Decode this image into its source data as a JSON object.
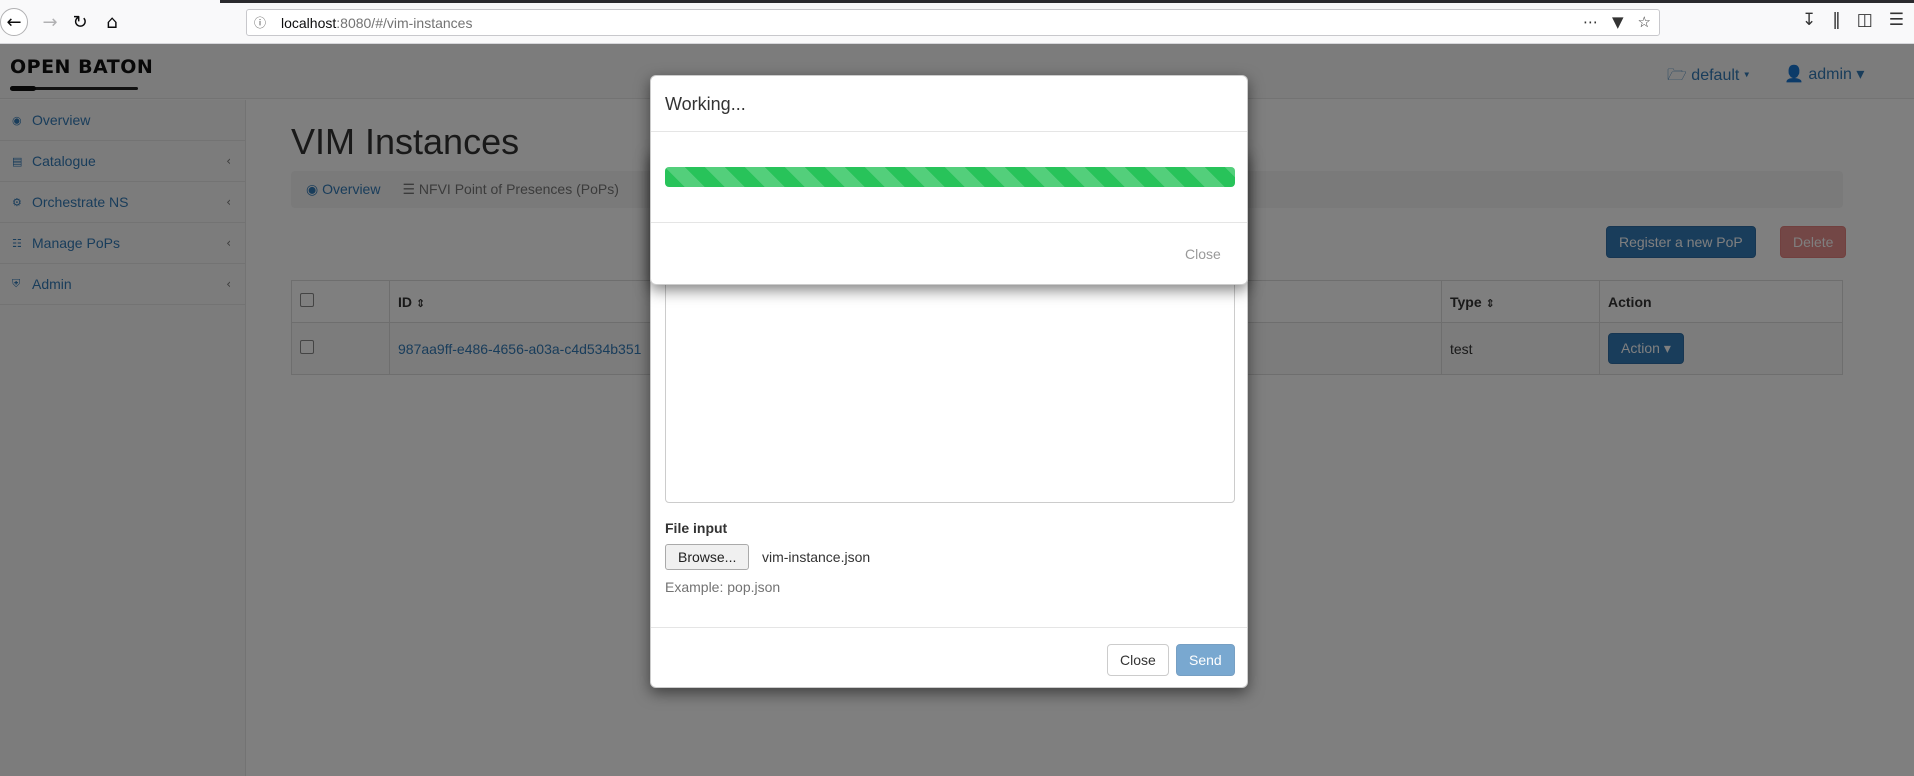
{
  "browser": {
    "url_host": "localhost",
    "url_rest": ":8080/#/vim-instances"
  },
  "header": {
    "logo": "OPEN BATON",
    "project": "default",
    "user": "admin"
  },
  "sidebar": {
    "items": [
      {
        "label": "Overview",
        "icon": "dashboard-icon"
      },
      {
        "label": "Catalogue",
        "icon": "database-icon"
      },
      {
        "label": "Orchestrate NS",
        "icon": "cogs-icon"
      },
      {
        "label": "Manage PoPs",
        "icon": "sitemap-icon"
      },
      {
        "label": "Admin",
        "icon": "shield-icon"
      }
    ]
  },
  "main": {
    "title": "VIM Instances",
    "breadcrumb": [
      "Overview",
      "NFVI Point of Presences (PoPs)"
    ],
    "register_label": "Register a new PoP",
    "delete_label": "Delete",
    "table": {
      "headers": [
        "ID",
        "Type",
        "Action"
      ],
      "rows": [
        {
          "id": "987aa9ff-e486-4656-a03a-c4d534b351",
          "type": "test",
          "action": "Action"
        }
      ]
    }
  },
  "register_modal": {
    "file_label": "File input",
    "browse_label": "Browse...",
    "file_name": "vim-instance.json",
    "help": "Example: pop.json",
    "close_label": "Close",
    "send_label": "Send"
  },
  "working_modal": {
    "title": "Working...",
    "progress_fraction": 1.0,
    "close_label": "Close",
    "bar_color": "#28c35a"
  }
}
